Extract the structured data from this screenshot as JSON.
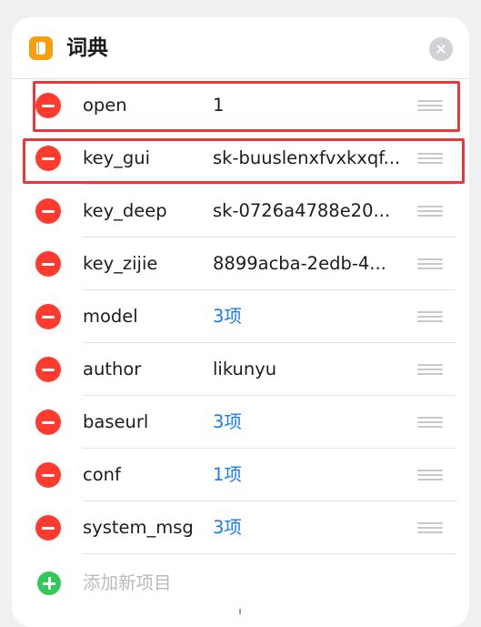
{
  "header": {
    "title": "词典",
    "app_icon": "book-icon",
    "close_icon": "close-icon"
  },
  "entries": [
    {
      "key": "open",
      "value": "1",
      "is_link": false
    },
    {
      "key": "key_gui",
      "value": "sk-buuslenxfvxkxqf...",
      "is_link": false
    },
    {
      "key": "key_deep",
      "value": "sk-0726a4788e20...",
      "is_link": false
    },
    {
      "key": "key_zijie",
      "value": "8899acba-2edb-4...",
      "is_link": false
    },
    {
      "key": "model",
      "value": "3项",
      "is_link": true
    },
    {
      "key": "author",
      "value": "likunyu",
      "is_link": false
    },
    {
      "key": "baseurl",
      "value": "3项",
      "is_link": true
    },
    {
      "key": "conf",
      "value": "1项",
      "is_link": true
    },
    {
      "key": "system_msg",
      "value": "3项",
      "is_link": true
    }
  ],
  "add_item": {
    "label": "添加新项目"
  },
  "colors": {
    "remove": "#ff3b30",
    "add": "#34c759",
    "link": "#1a7cf5",
    "highlight": "#e8373d",
    "app_icon": "#f59f0a"
  }
}
